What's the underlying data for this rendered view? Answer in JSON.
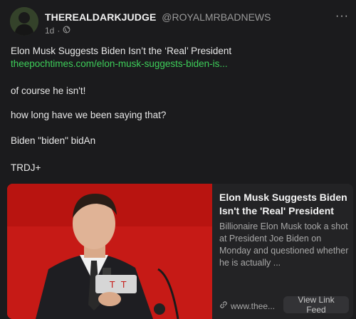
{
  "post": {
    "display_name": "THEREALDARKJUDGE",
    "handle": "@ROYALMRBADNEWS",
    "timestamp": "1d",
    "more_label": "···",
    "title_line": "Elon Musk Suggests Biden Isn’t the ‘Real’ President",
    "link_text": "theepochtimes.com/elon-musk-suggests-biden-is...",
    "paragraphs": [
      "of course he isn't!",
      "how long have we been saying that?",
      "Biden \"biden\" bidAn",
      "TRDJ+"
    ]
  },
  "card": {
    "title": "Elon Musk Suggests Biden Isn't the 'Real' President",
    "description": "Billionaire Elon Musk took a shot at President Joe Biden on Monday and questioned whether he is actually ...",
    "domain": "www.thee...",
    "button_label": "View Link Feed"
  },
  "icons": {
    "visibility": "globe-icon",
    "link": "link-icon",
    "more": "more-icon"
  },
  "colors": {
    "background": "#1b1b1d",
    "link": "#3ecf5a",
    "card_image_bg": "#c61a16"
  }
}
